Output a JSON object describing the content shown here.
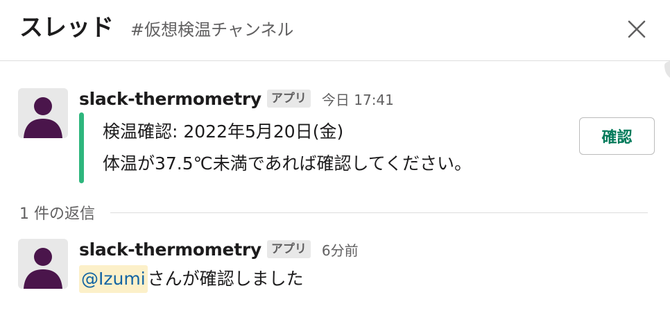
{
  "header": {
    "title": "スレッド",
    "channel": "#仮想検温チャンネル",
    "close_icon": "close-icon"
  },
  "thread": {
    "parent": {
      "sender": "slack-thermometry",
      "badge": "アプリ",
      "timestamp": "今日 17:41",
      "attachment": {
        "accent_color": "#2eb67d",
        "line1": "検温確認: 2022年5月20日(金)",
        "line2": "体温が37.5℃未満であれば確認してください。"
      },
      "action_button": "確認"
    },
    "reply_count_label": "1 件の返信",
    "replies": [
      {
        "sender": "slack-thermometry",
        "badge": "アプリ",
        "timestamp": "6分前",
        "mention": "@Izumi",
        "text": "さんが確認しました"
      }
    ]
  },
  "colors": {
    "avatar_figure": "#4a154b",
    "button_text": "#007a5a",
    "mention_bg": "#fcf0c9",
    "mention_text": "#1264a3"
  }
}
